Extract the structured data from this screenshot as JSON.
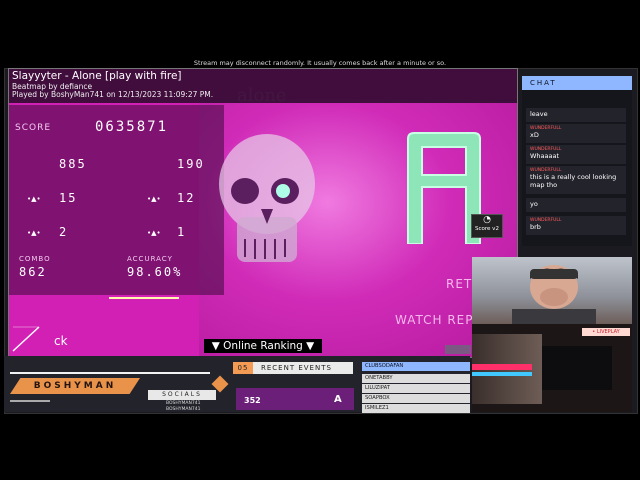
{
  "banner": "Stream may disconnect randomly. It usually comes back after a minute or so.",
  "game": {
    "song_title": "Slayyyter - Alone [play with fire]",
    "beatmap_by": "Beatmap by defiance",
    "played_by": "Played by BoshyMan741 on 12/13/2023 11:09:27 PM.",
    "score_label": "SCORE",
    "score": "0635871",
    "hits": [
      {
        "left_label": "",
        "left_value": "885",
        "right_label": "",
        "right_value": "190"
      },
      {
        "left_label": "•▲•",
        "left_value": "15",
        "right_label": "•▲•",
        "right_value": "12"
      },
      {
        "left_label": "•▲•",
        "left_value": "2",
        "right_label": "•▲•",
        "right_value": "1"
      }
    ],
    "combo_label": "COMBO",
    "combo": "862",
    "accuracy_label": "ACCURACY",
    "accuracy": "98.60%",
    "grade": "A",
    "score_btn_label": "Score v2",
    "retry": "RETRY",
    "watch": "WATCH REPLAY",
    "back": "ck",
    "online_ranking": "▼ Online Ranking ▼",
    "bg_text": "alone"
  },
  "chat": {
    "title": "CHAT",
    "messages": [
      {
        "user": "",
        "text": "leave"
      },
      {
        "user": "WUNDERFULL",
        "text": "xD"
      },
      {
        "user": "WUNDERFULL",
        "text": "Whaaaat"
      },
      {
        "user": "WUNDERFULL",
        "text": "this is a really cool looking map tho"
      },
      {
        "user": "",
        "text": "yo"
      },
      {
        "user": "WUNDERFULL",
        "text": "brb"
      }
    ]
  },
  "webcam": {
    "liveplay": "• LIVEPLAY"
  },
  "footer": {
    "name": "BOSHYMAN",
    "socials_label": "SOCIALS",
    "social_1": "BOSHYMAN741",
    "social_2": "BOSHYMAN741",
    "recent_num": "05",
    "recent_label": "RECENT EVENTS",
    "recent_score": "352",
    "recent_grade": "A",
    "leaderboard": [
      "CLUBSODAFAN",
      "ONETABBY",
      "LILUZIPAT",
      "SOAPBOX",
      "ISMILEZ1"
    ]
  },
  "colors": {
    "game_bg": "#d21fb4",
    "grade": "#8ee6b8",
    "accent_orange": "#e8924a",
    "chat_head": "#8fb7ff"
  }
}
